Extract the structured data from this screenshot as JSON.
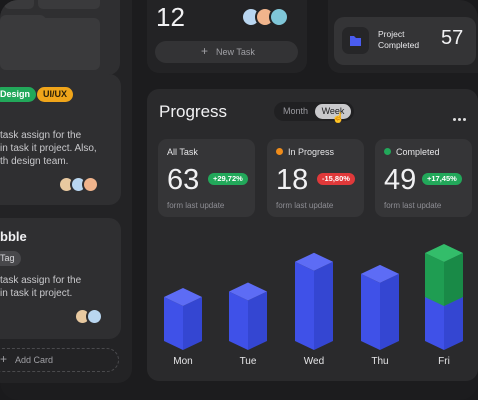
{
  "top_counter": {
    "value": "12",
    "new_task_label": "New Task"
  },
  "project_completed": {
    "label_line1": "Project",
    "label_line2": "Completed",
    "value": "57"
  },
  "left_cards": {
    "tags": [
      "Design",
      "UI/UX"
    ],
    "card1_text": [
      "task assign for the",
      "in task it project. Also,",
      "th design team."
    ],
    "card2_title": "bble",
    "card2_tag": "Tag",
    "card2_text": [
      "task assign for the",
      "in task it project."
    ],
    "add_card_label": "Add Card"
  },
  "progress": {
    "title": "Progress",
    "tabs": [
      {
        "label": "Month"
      },
      {
        "label": "Week"
      }
    ],
    "active_tab": "Week",
    "stats": [
      {
        "label": "All Task",
        "value": "63",
        "delta": "+29,72%",
        "footnote": "form last update"
      },
      {
        "label": "In Progress",
        "value": "18",
        "delta": "-15,80%",
        "footnote": "form last update"
      },
      {
        "label": "Completed",
        "value": "49",
        "delta": "+17,45%",
        "footnote": "form last update"
      }
    ]
  },
  "colors": {
    "accent_blue": "#4a5cf0",
    "green": "#22a85a",
    "red": "#e0393a",
    "orange": "#f08c1a"
  },
  "chart_data": {
    "type": "bar",
    "categories": [
      "Mon",
      "Tue",
      "Wed",
      "Thu",
      "Fri"
    ],
    "series": [
      {
        "values": [
          40,
          45,
          72,
          61,
          40
        ]
      },
      {
        "values": [
          0,
          0,
          0,
          0,
          40
        ]
      }
    ],
    "ylim": [
      0,
      100
    ],
    "grid": false,
    "xlabel": "",
    "ylabel": ""
  }
}
